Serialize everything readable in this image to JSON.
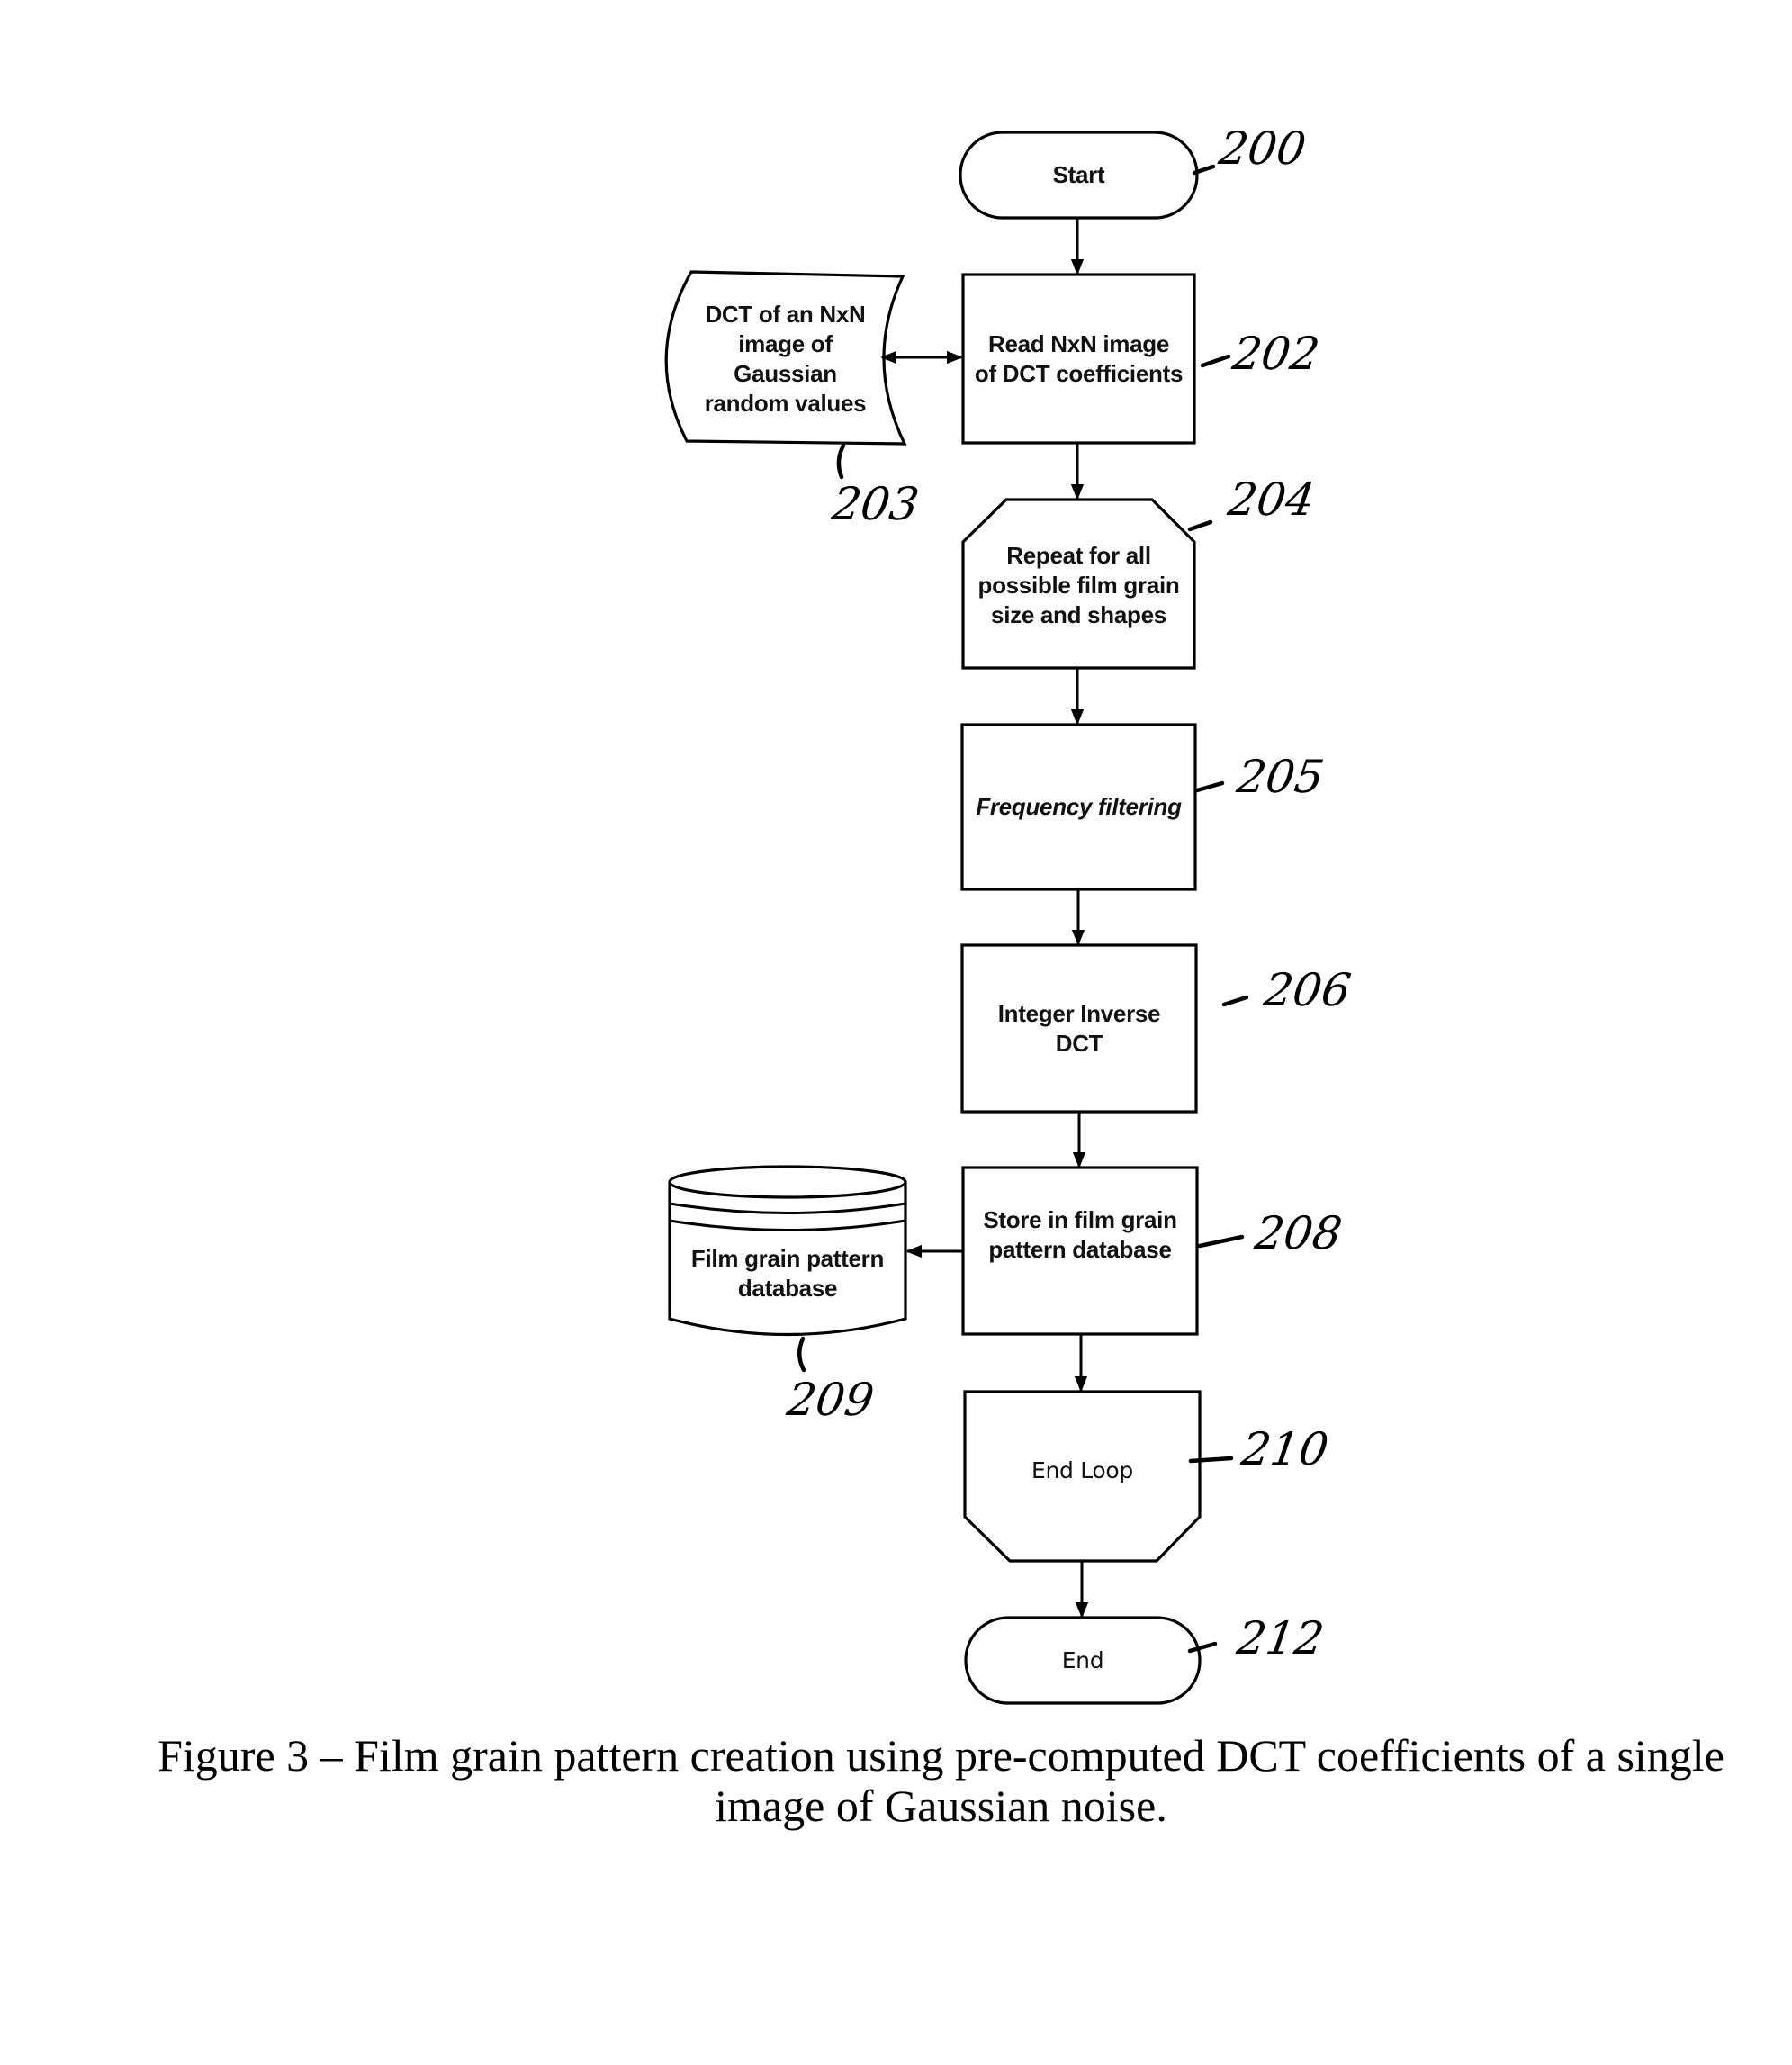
{
  "figure": {
    "caption_line1": "Figure 3 – Film grain pattern creation using pre-computed DCT coefficients of a single",
    "caption_line2": "image of Gaussian noise."
  },
  "nodes": {
    "start": {
      "shape": "terminal",
      "label": "Start",
      "ref": "200"
    },
    "read_dct": {
      "shape": "process",
      "label": "Read NxN image\nof DCT coefficients",
      "ref": "202"
    },
    "dct_source": {
      "shape": "stored-data",
      "label": "DCT of an NxN\nimage of\nGaussian\nrandom values",
      "ref": "203"
    },
    "loop_start": {
      "shape": "loop-limit-start",
      "label": "Repeat for all\npossible film grain\nsize and shapes",
      "ref": "204"
    },
    "freq_filter": {
      "shape": "process",
      "label": "Frequency filtering",
      "ref": "205"
    },
    "inverse_dct": {
      "shape": "process",
      "label": "Integer Inverse\nDCT",
      "ref": "206"
    },
    "store": {
      "shape": "process",
      "label": "Store in film grain\npattern database",
      "ref": "208"
    },
    "database": {
      "shape": "database",
      "label": "Film grain pattern\ndatabase",
      "ref": "209"
    },
    "loop_end": {
      "shape": "loop-limit-end",
      "label": "End Loop",
      "ref": "210"
    },
    "end": {
      "shape": "terminal",
      "label": "End",
      "ref": "212"
    }
  },
  "edges": [
    {
      "from": "start",
      "to": "read_dct",
      "type": "arrow"
    },
    {
      "from": "dct_source",
      "to": "read_dct",
      "type": "bidirectional"
    },
    {
      "from": "read_dct",
      "to": "loop_start",
      "type": "arrow"
    },
    {
      "from": "loop_start",
      "to": "freq_filter",
      "type": "arrow"
    },
    {
      "from": "freq_filter",
      "to": "inverse_dct",
      "type": "arrow"
    },
    {
      "from": "inverse_dct",
      "to": "store",
      "type": "arrow"
    },
    {
      "from": "store",
      "to": "database",
      "type": "arrow"
    },
    {
      "from": "store",
      "to": "loop_end",
      "type": "arrow"
    },
    {
      "from": "loop_end",
      "to": "end",
      "type": "arrow"
    }
  ]
}
